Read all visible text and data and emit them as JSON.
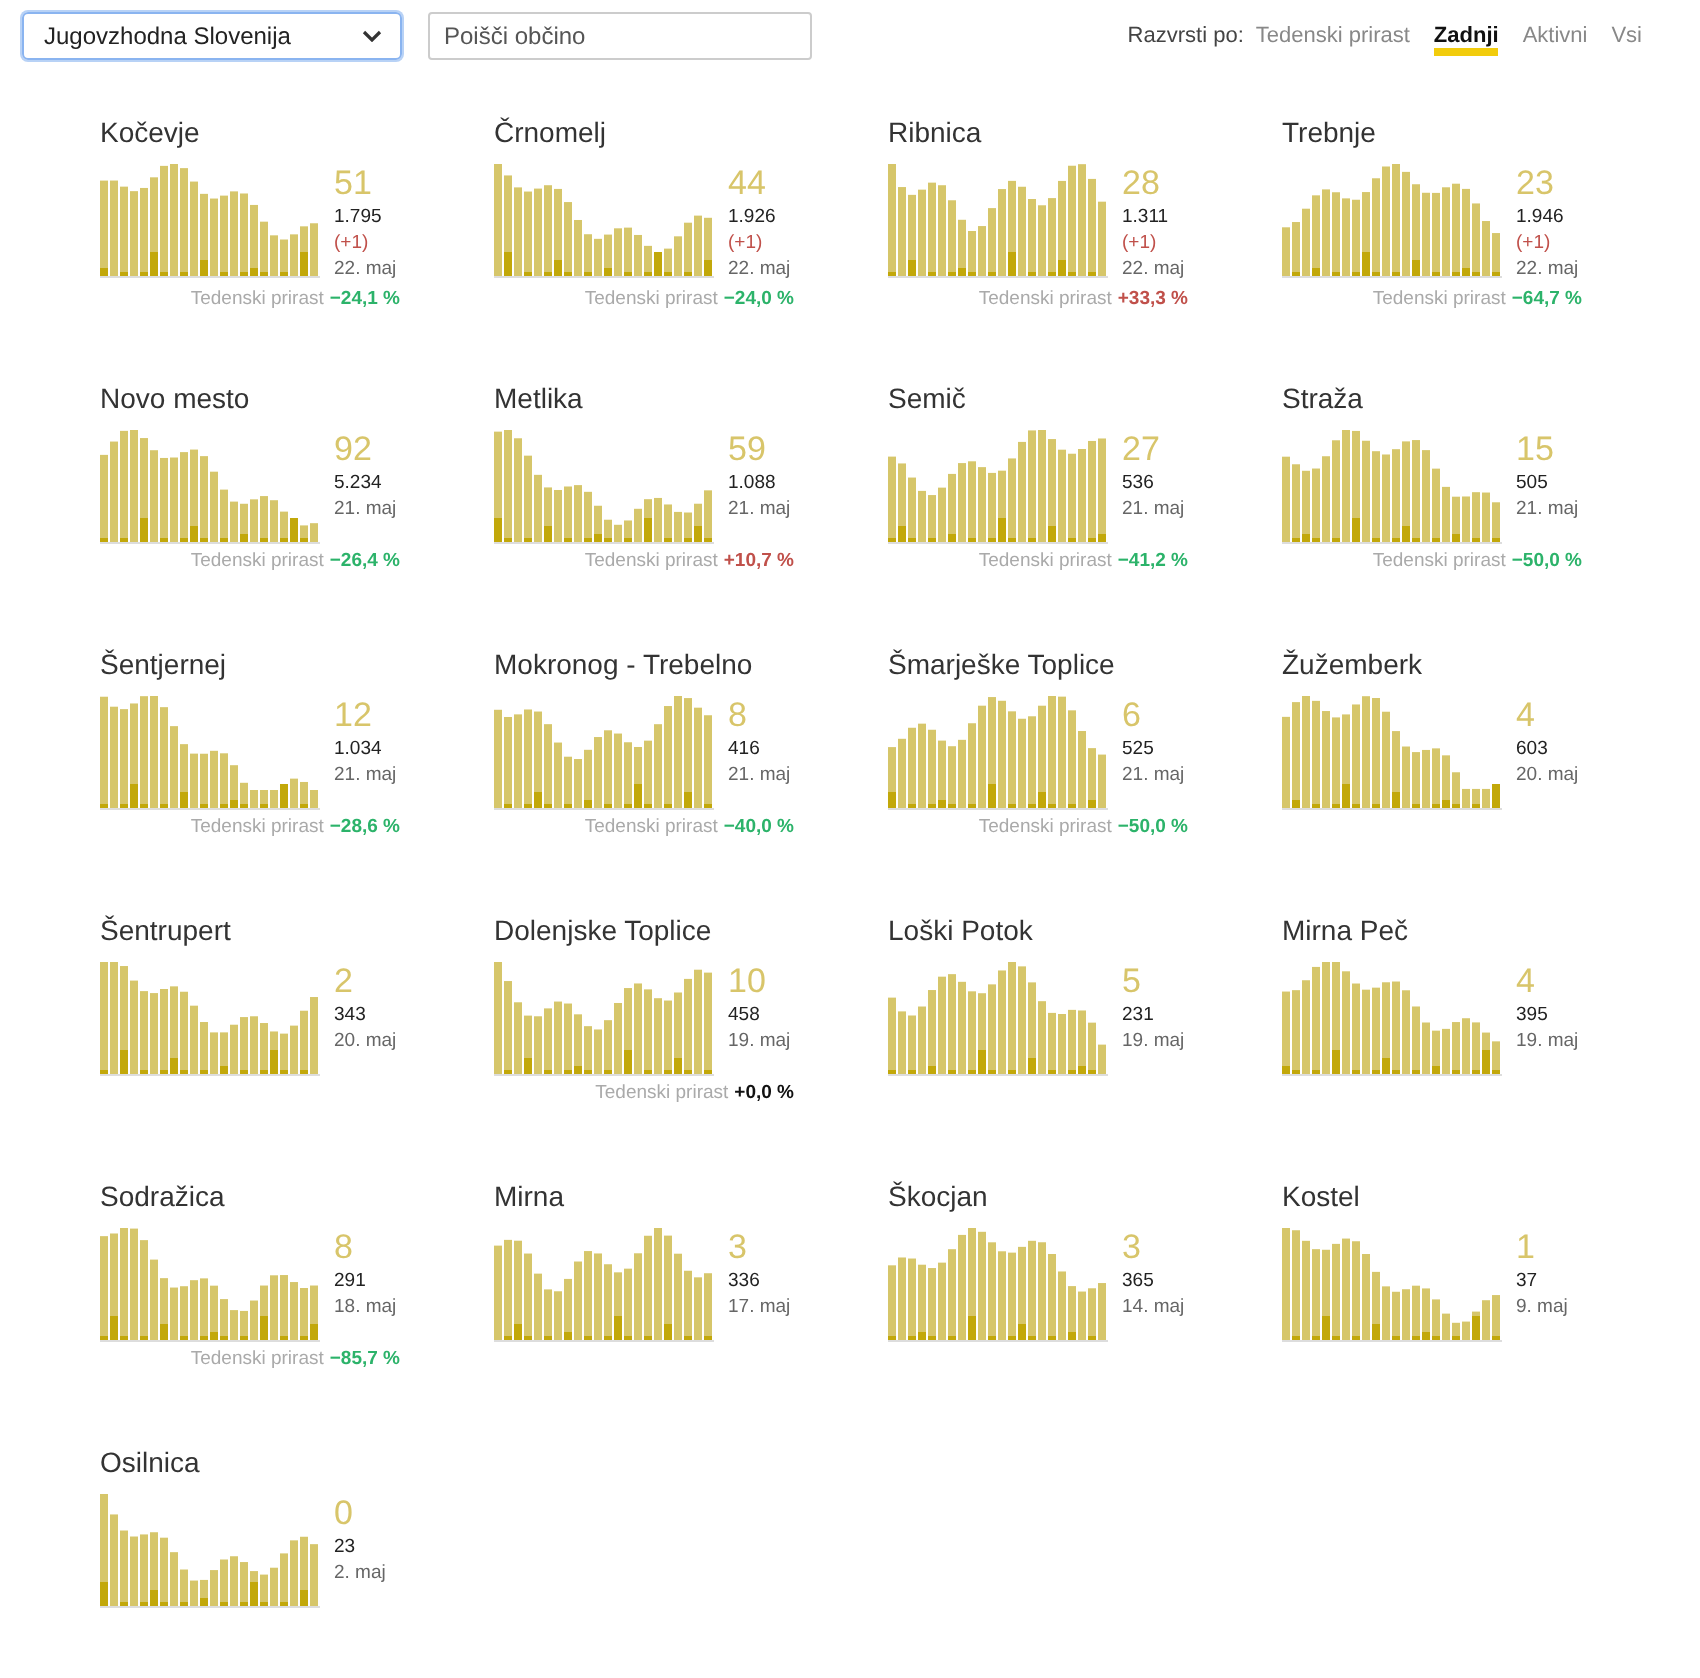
{
  "region_select": {
    "value": "Jugovzhodna Slovenija"
  },
  "search": {
    "placeholder": "Poišči občino"
  },
  "sort": {
    "label": "Razvrsti po:",
    "options": [
      {
        "label": "Tedenski prirast",
        "selected": false
      },
      {
        "label": "Zadnji",
        "selected": true
      },
      {
        "label": "Aktivni",
        "selected": false
      },
      {
        "label": "Vsi",
        "selected": false
      }
    ]
  },
  "cards": [
    {
      "name": "Kočevje",
      "active": "51",
      "total": "1.795",
      "delta": "(+1)",
      "date": "22. maj",
      "growth_label": "Tedenski prirast",
      "growth": "−24,1 %",
      "color": "#2cb36a"
    },
    {
      "name": "Črnomelj",
      "active": "44",
      "total": "1.926",
      "delta": "(+1)",
      "date": "22. maj",
      "growth_label": "Tedenski prirast",
      "growth": "−24,0 %",
      "color": "#2cb36a"
    },
    {
      "name": "Ribnica",
      "active": "28",
      "total": "1.311",
      "delta": "(+1)",
      "date": "22. maj",
      "growth_label": "Tedenski prirast",
      "growth": "+33,3 %",
      "color": "#c0504a"
    },
    {
      "name": "Trebnje",
      "active": "23",
      "total": "1.946",
      "delta": "(+1)",
      "date": "22. maj",
      "growth_label": "Tedenski prirast",
      "growth": "−64,7 %",
      "color": "#2cb36a"
    },
    {
      "name": "Novo mesto",
      "active": "92",
      "total": "5.234",
      "date": "21. maj",
      "growth_label": "Tedenski prirast",
      "growth": "−26,4 %",
      "color": "#2cb36a"
    },
    {
      "name": "Metlika",
      "active": "59",
      "total": "1.088",
      "date": "21. maj",
      "growth_label": "Tedenski prirast",
      "growth": "+10,7 %",
      "color": "#c0504a"
    },
    {
      "name": "Semič",
      "active": "27",
      "total": "536",
      "date": "21. maj",
      "growth_label": "Tedenski prirast",
      "growth": "−41,2 %",
      "color": "#2cb36a"
    },
    {
      "name": "Straža",
      "active": "15",
      "total": "505",
      "date": "21. maj",
      "growth_label": "Tedenski prirast",
      "growth": "−50,0 %",
      "color": "#2cb36a"
    },
    {
      "name": "Šentjernej",
      "active": "12",
      "total": "1.034",
      "date": "21. maj",
      "growth_label": "Tedenski prirast",
      "growth": "−28,6 %",
      "color": "#2cb36a"
    },
    {
      "name": "Mokronog - Trebelno",
      "active": "8",
      "total": "416",
      "date": "21. maj",
      "growth_label": "Tedenski prirast",
      "growth": "−40,0 %",
      "color": "#2cb36a"
    },
    {
      "name": "Šmarješke Toplice",
      "active": "6",
      "total": "525",
      "date": "21. maj",
      "growth_label": "Tedenski prirast",
      "growth": "−50,0 %",
      "color": "#2cb36a"
    },
    {
      "name": "Žužemberk",
      "active": "4",
      "total": "603",
      "date": "20. maj"
    },
    {
      "name": "Šentrupert",
      "active": "2",
      "total": "343",
      "date": "20. maj"
    },
    {
      "name": "Dolenjske Toplice",
      "active": "10",
      "total": "458",
      "date": "19. maj",
      "growth_label": "Tedenski prirast",
      "growth": "+0,0 %",
      "color": "#111111"
    },
    {
      "name": "Loški Potok",
      "active": "5",
      "total": "231",
      "date": "19. maj"
    },
    {
      "name": "Mirna Peč",
      "active": "4",
      "total": "395",
      "date": "19. maj"
    },
    {
      "name": "Sodražica",
      "active": "8",
      "total": "291",
      "date": "18. maj",
      "growth_label": "Tedenski prirast",
      "growth": "−85,7 %",
      "color": "#2cb36a"
    },
    {
      "name": "Mirna",
      "active": "3",
      "total": "336",
      "date": "17. maj"
    },
    {
      "name": "Škocjan",
      "active": "3",
      "total": "365",
      "date": "14. maj"
    },
    {
      "name": "Kostel",
      "active": "1",
      "total": "37",
      "date": "9. maj"
    },
    {
      "name": "Osilnica",
      "active": "0",
      "total": "23",
      "date": "2. maj"
    }
  ]
}
